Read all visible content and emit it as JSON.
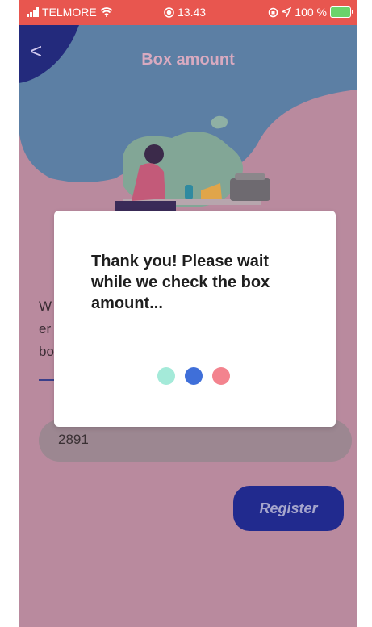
{
  "status_bar": {
    "carrier": "TELMORE",
    "time": "13.43",
    "battery": "100 %"
  },
  "header": {
    "title": "Box amount",
    "back_glyph": "<"
  },
  "body_text": {
    "line1": "W",
    "line2": "er",
    "line3": "bo"
  },
  "box_amount_input": {
    "value": "2891"
  },
  "register_button": {
    "label": "Register"
  },
  "modal": {
    "message": "Thank you! Please wait while we check the box amount...",
    "dot_colors": [
      "#a4ead9",
      "#3f6fd9",
      "#f3838e"
    ]
  },
  "colors": {
    "status_bar": "#e8564f",
    "backdrop": "#b98a9e",
    "accent": "#212a8e"
  }
}
